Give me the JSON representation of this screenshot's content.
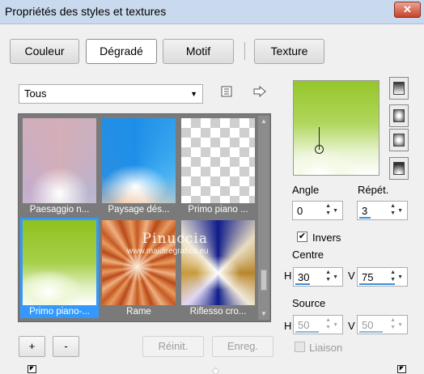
{
  "window": {
    "title": "Propriétés des styles et textures",
    "close_label": "✕"
  },
  "tabs": [
    {
      "label": "Couleur",
      "active": false
    },
    {
      "label": "Dégradé",
      "active": true
    },
    {
      "label": "Motif",
      "active": false
    },
    {
      "label": "Texture",
      "active": false
    }
  ],
  "category_dropdown": {
    "value": "Tous"
  },
  "gallery": {
    "items": [
      {
        "label": "Paesaggio n...",
        "selected": false
      },
      {
        "label": "Paysage dés...",
        "selected": false
      },
      {
        "label": "Primo piano ...",
        "selected": false
      },
      {
        "label": "Primo piano-...",
        "selected": true
      },
      {
        "label": "Rame",
        "selected": false
      },
      {
        "label": "Riflesso cro...",
        "selected": false
      }
    ],
    "watermark_line1": "Pinuccia",
    "watermark_line2": "www.maidiregrafica.eu"
  },
  "angle": {
    "label": "Angle",
    "value": "0"
  },
  "repeat": {
    "label": "Répét.",
    "value": "3"
  },
  "invert": {
    "label": "Invers",
    "checked": true
  },
  "center": {
    "label": "Centre",
    "h_label": "H",
    "h_value": "30",
    "v_label": "V",
    "v_value": "75"
  },
  "source": {
    "label": "Source",
    "h_label": "H",
    "h_value": "50",
    "v_label": "V",
    "v_value": "50"
  },
  "link": {
    "label": "Liaison",
    "checked": false
  },
  "buttons": {
    "add": "+",
    "remove": "-",
    "reset": "Réinit.",
    "save": "Enreg."
  },
  "colors": {
    "accent": "#3399ff",
    "title_bar": "#c9d9ee",
    "close": "#c7432a"
  }
}
